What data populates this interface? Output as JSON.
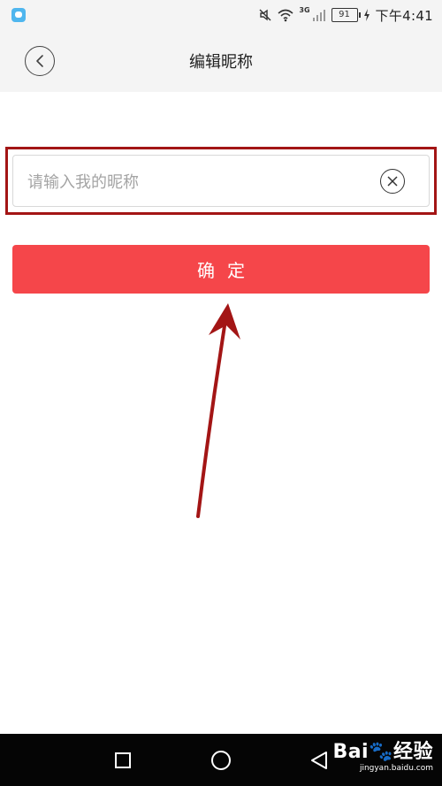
{
  "status_bar": {
    "network_tag": "3G",
    "battery": "91",
    "time": "下午4:41",
    "icons": [
      "app-notification-icon",
      "mute-icon",
      "wifi-icon",
      "signal-icon",
      "battery-icon",
      "charging-icon"
    ]
  },
  "header": {
    "title": "编辑昵称",
    "back_icon": "chevron-left-icon"
  },
  "form": {
    "nickname_placeholder": "请输入我的昵称",
    "nickname_value": "",
    "clear_icon": "clear-icon",
    "confirm_label": "确定"
  },
  "annotation": {
    "color": "#a31515",
    "arrow_target": "confirm-button"
  },
  "colors": {
    "accent": "#f5464a",
    "annotation": "#a31515"
  },
  "nav_bar": {
    "icons": [
      "recent-apps-icon",
      "home-icon",
      "back-icon"
    ]
  },
  "watermark": {
    "main": "Bai🐾经验",
    "sub": "jingyan.baidu.com"
  }
}
